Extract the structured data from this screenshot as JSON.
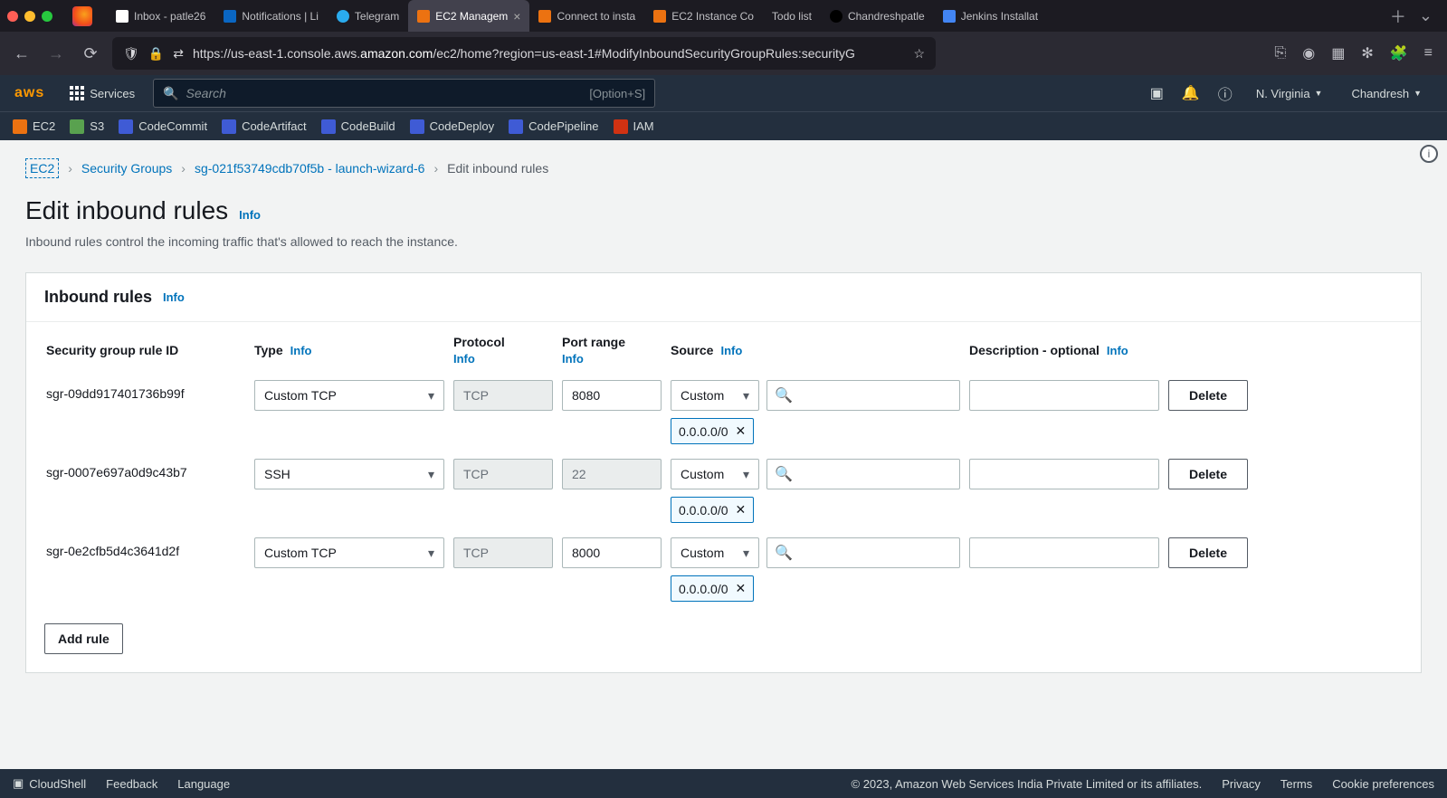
{
  "browser": {
    "tabs": [
      {
        "label": "Inbox - patle26"
      },
      {
        "label": "Notifications | Li"
      },
      {
        "label": "Telegram"
      },
      {
        "label": "EC2 Managem",
        "active": true
      },
      {
        "label": "Connect to insta"
      },
      {
        "label": "EC2 Instance Co"
      },
      {
        "label": "Todo list"
      },
      {
        "label": "Chandreshpatle"
      },
      {
        "label": "Jenkins Installat"
      }
    ],
    "url_host": "amazon.com",
    "url_prefix": "https://us-east-1.console.aws.",
    "url_suffix": "/ec2/home?region=us-east-1#ModifyInboundSecurityGroupRules:securityG"
  },
  "aws": {
    "services_label": "Services",
    "search_placeholder": "Search",
    "search_kbd": "[Option+S]",
    "region": "N. Virginia",
    "user": "Chandresh",
    "shortcuts": [
      "EC2",
      "S3",
      "CodeCommit",
      "CodeArtifact",
      "CodeBuild",
      "CodeDeploy",
      "CodePipeline",
      "IAM"
    ]
  },
  "breadcrumb": {
    "items": [
      "EC2",
      "Security Groups",
      "sg-021f53749cdb70f5b - launch-wizard-6"
    ],
    "current": "Edit inbound rules"
  },
  "page": {
    "title": "Edit inbound rules",
    "info": "Info",
    "subtitle": "Inbound rules control the incoming traffic that's allowed to reach the instance."
  },
  "panel": {
    "title": "Inbound rules",
    "info": "Info",
    "add_rule": "Add rule",
    "headers": {
      "sgrid": "Security group rule ID",
      "type": "Type",
      "protocol": "Protocol",
      "portrange": "Port range",
      "source": "Source",
      "description": "Description - optional"
    }
  },
  "rules": [
    {
      "id": "sgr-09dd917401736b99f",
      "type": "Custom TCP",
      "protocol": "TCP",
      "port": "8080",
      "source_mode": "Custom",
      "cidr": "0.0.0.0/0",
      "desc": "",
      "delete": "Delete"
    },
    {
      "id": "sgr-0007e697a0d9c43b7",
      "type": "SSH",
      "protocol": "TCP",
      "port": "22",
      "source_mode": "Custom",
      "cidr": "0.0.0.0/0",
      "desc": "",
      "delete": "Delete",
      "port_disabled": true
    },
    {
      "id": "sgr-0e2cfb5d4c3641d2f",
      "type": "Custom TCP",
      "protocol": "TCP",
      "port": "8000",
      "source_mode": "Custom",
      "cidr": "0.0.0.0/0",
      "desc": "",
      "delete": "Delete"
    }
  ],
  "footer": {
    "cloudshell": "CloudShell",
    "feedback": "Feedback",
    "language": "Language",
    "copyright": "© 2023, Amazon Web Services India Private Limited or its affiliates.",
    "links": [
      "Privacy",
      "Terms",
      "Cookie preferences"
    ]
  }
}
